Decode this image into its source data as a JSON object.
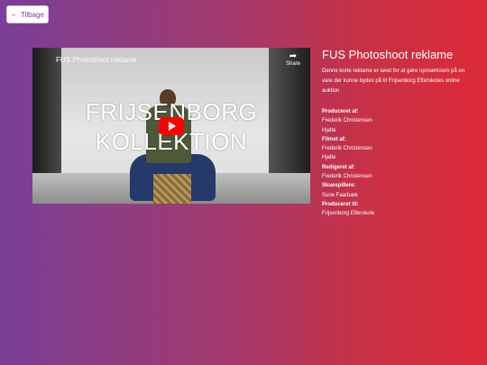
{
  "back_button": {
    "label": "Tilbage",
    "icon": "arrow-left-icon"
  },
  "video": {
    "title": "FUS Photoshoot reklame",
    "share_label": "Share",
    "overlay_line1": "FRIJSENBORG",
    "overlay_line2": "KOLLEKTION",
    "play_color": "#ff0000"
  },
  "info": {
    "title": "FUS Photoshoot reklame",
    "description": "Denne korte reklame er lavet for at gøre opmærksom på en vare der kunne bydes på til Frijsenborg Efterskoles online auktion",
    "credits": [
      {
        "heading": "Produceret af:",
        "lines": [
          "Frederik Christensen",
          "Hjalte"
        ]
      },
      {
        "heading": "Filmet af:",
        "lines": [
          "Frederik Christensen",
          "Hjalte"
        ]
      },
      {
        "heading": "Redigeret af:",
        "lines": [
          "Frederik Christensen"
        ]
      },
      {
        "heading": "Skuespillere:",
        "lines": [
          "Sune Faarbæk"
        ]
      },
      {
        "heading": "Produceret til:",
        "lines": [
          "Frijsenborg Efterskole"
        ]
      }
    ]
  },
  "colors": {
    "gradient_start": "#7a3f97",
    "gradient_end": "#dc2a38"
  }
}
